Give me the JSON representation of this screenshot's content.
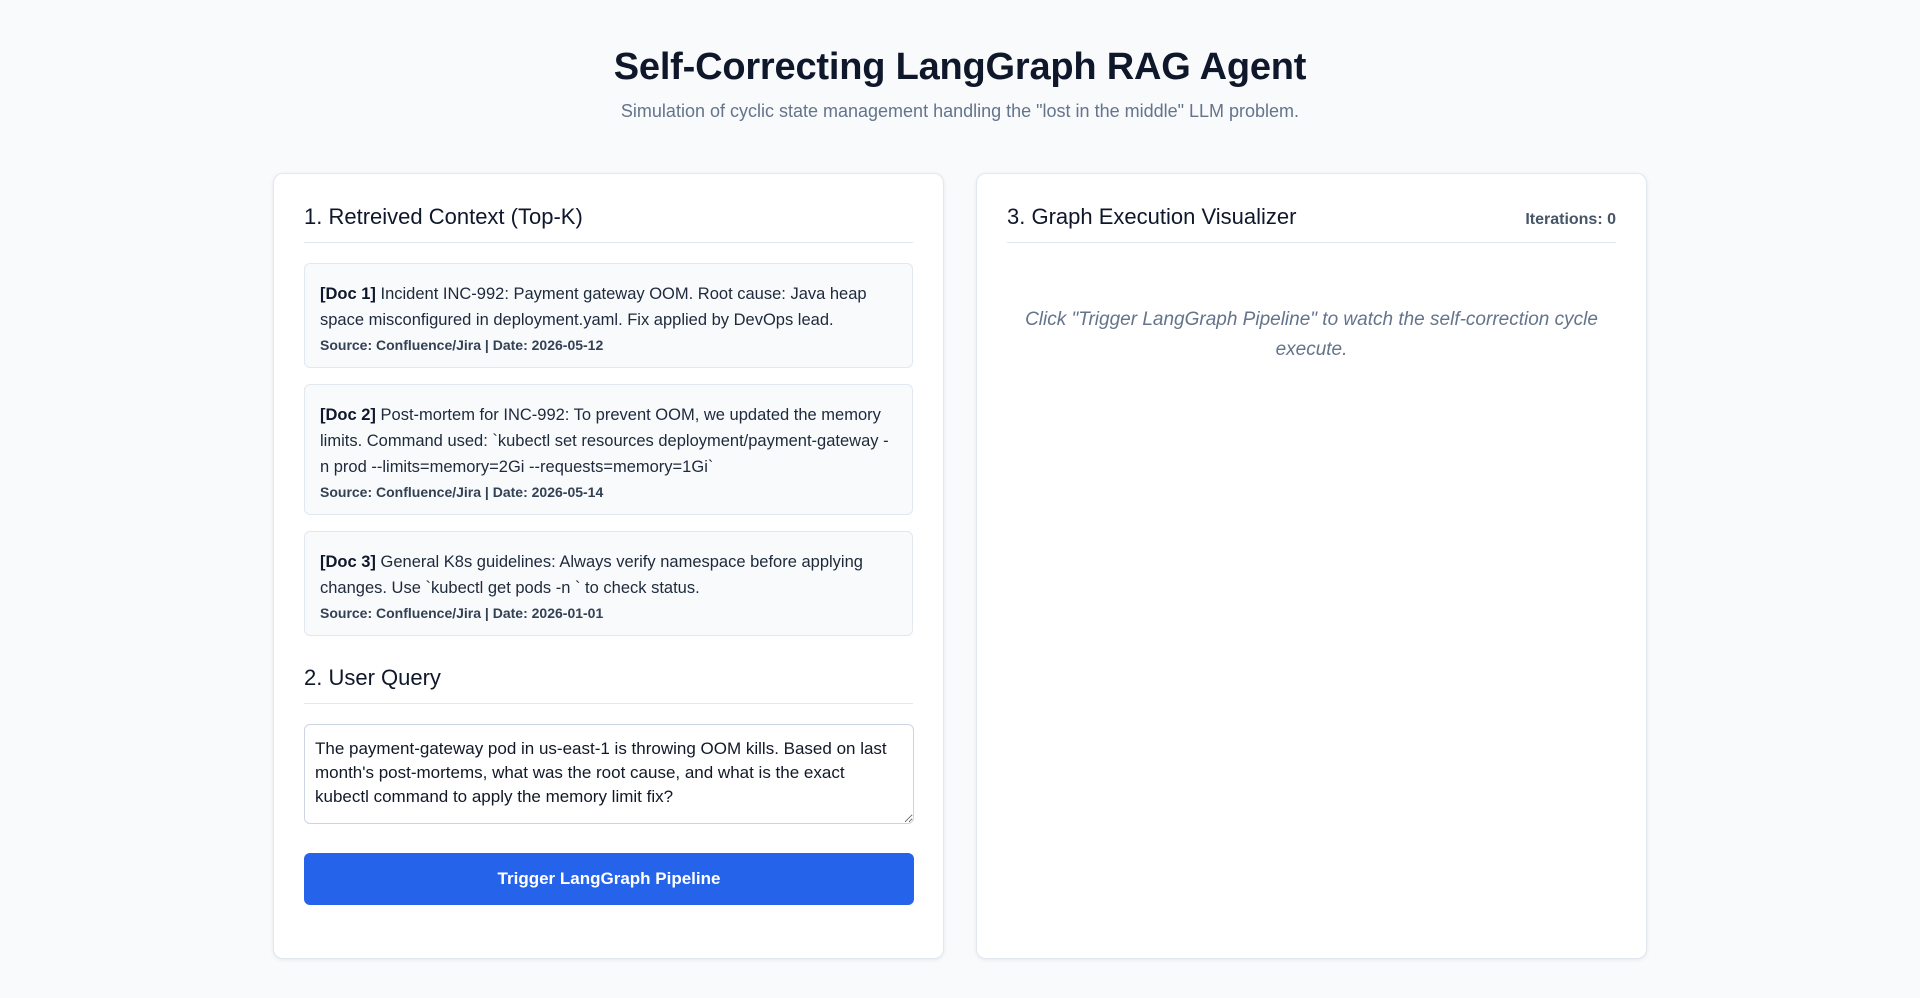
{
  "header": {
    "title": "Self-Correcting LangGraph RAG Agent",
    "subtitle": "Simulation of cyclic state management handling the \"lost in the middle\" LLM problem."
  },
  "context": {
    "title": "1. Retreived Context (Top-K)",
    "docs": [
      {
        "tag": "[Doc 1]",
        "text": " Incident INC-992: Payment gateway OOM. Root cause: Java heap space misconfigured in deployment.yaml. Fix applied by DevOps lead.",
        "meta": "Source: Confluence/Jira | Date: 2026-05-12"
      },
      {
        "tag": "[Doc 2]",
        "text": " Post-mortem for INC-992: To prevent OOM, we updated the memory limits. Command used: `kubectl set resources deployment/payment-gateway -n prod --limits=memory=2Gi --requests=memory=1Gi`",
        "meta": "Source: Confluence/Jira | Date: 2026-05-14"
      },
      {
        "tag": "[Doc 3]",
        "text": " General K8s guidelines: Always verify namespace before applying changes. Use `kubectl get pods -n ` to check status.",
        "meta": "Source: Confluence/Jira | Date: 2026-01-01"
      }
    ]
  },
  "query": {
    "title": "2. User Query",
    "value": "The payment-gateway pod in us-east-1 is throwing OOM kills. Based on last month's post-mortems, what was the root cause, and what is the exact kubectl command to apply the memory limit fix?",
    "button_label": "Trigger LangGraph Pipeline"
  },
  "visualizer": {
    "title": "3. Graph Execution Visualizer",
    "iterations": "Iterations: 0",
    "placeholder": "Click \"Trigger LangGraph Pipeline\" to watch the self-correction cycle execute."
  }
}
